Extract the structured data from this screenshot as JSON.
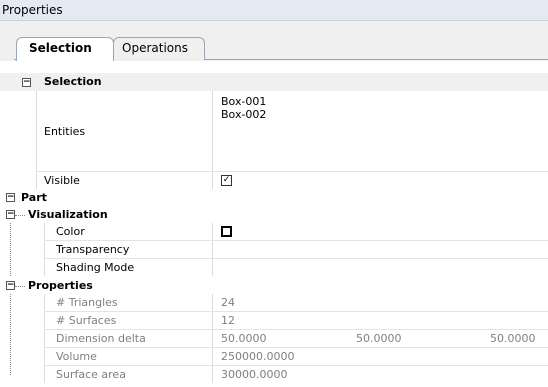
{
  "window": {
    "title": "Properties"
  },
  "tabs": [
    {
      "label": "Selection",
      "active": true
    },
    {
      "label": "Operations",
      "active": false
    }
  ],
  "expander_symbol": "−",
  "checkbox_checked": "✓",
  "categories": {
    "selection": {
      "label": "Selection"
    },
    "part": {
      "label": "Part"
    },
    "visualization": {
      "label": "Visualization"
    },
    "properties": {
      "label": "Properties"
    }
  },
  "selection": {
    "entities": {
      "label": "Entities",
      "values": [
        "Box-001",
        "Box-002"
      ]
    },
    "visible": {
      "label": "Visible",
      "checked": true
    }
  },
  "visualization": {
    "color": {
      "label": "Color",
      "value_color": "#ffffff"
    },
    "transparency": {
      "label": "Transparency",
      "value": ""
    },
    "shading_mode": {
      "label": "Shading Mode",
      "value": ""
    }
  },
  "properties": {
    "triangles": {
      "label": "# Triangles",
      "value": "24"
    },
    "surfaces": {
      "label": "# Surfaces",
      "value": "12"
    },
    "dimension_delta": {
      "label": "Dimension delta",
      "values": [
        "50.0000",
        "50.0000",
        "50.0000"
      ]
    },
    "volume": {
      "label": "Volume",
      "value": "250000.0000"
    },
    "surface_area": {
      "label": "Surface area",
      "value": "30000.0000"
    }
  },
  "colors": {
    "title_bar": "#e3eaf3",
    "category_bg": "#f0f0f0",
    "readonly_text": "#808080"
  }
}
